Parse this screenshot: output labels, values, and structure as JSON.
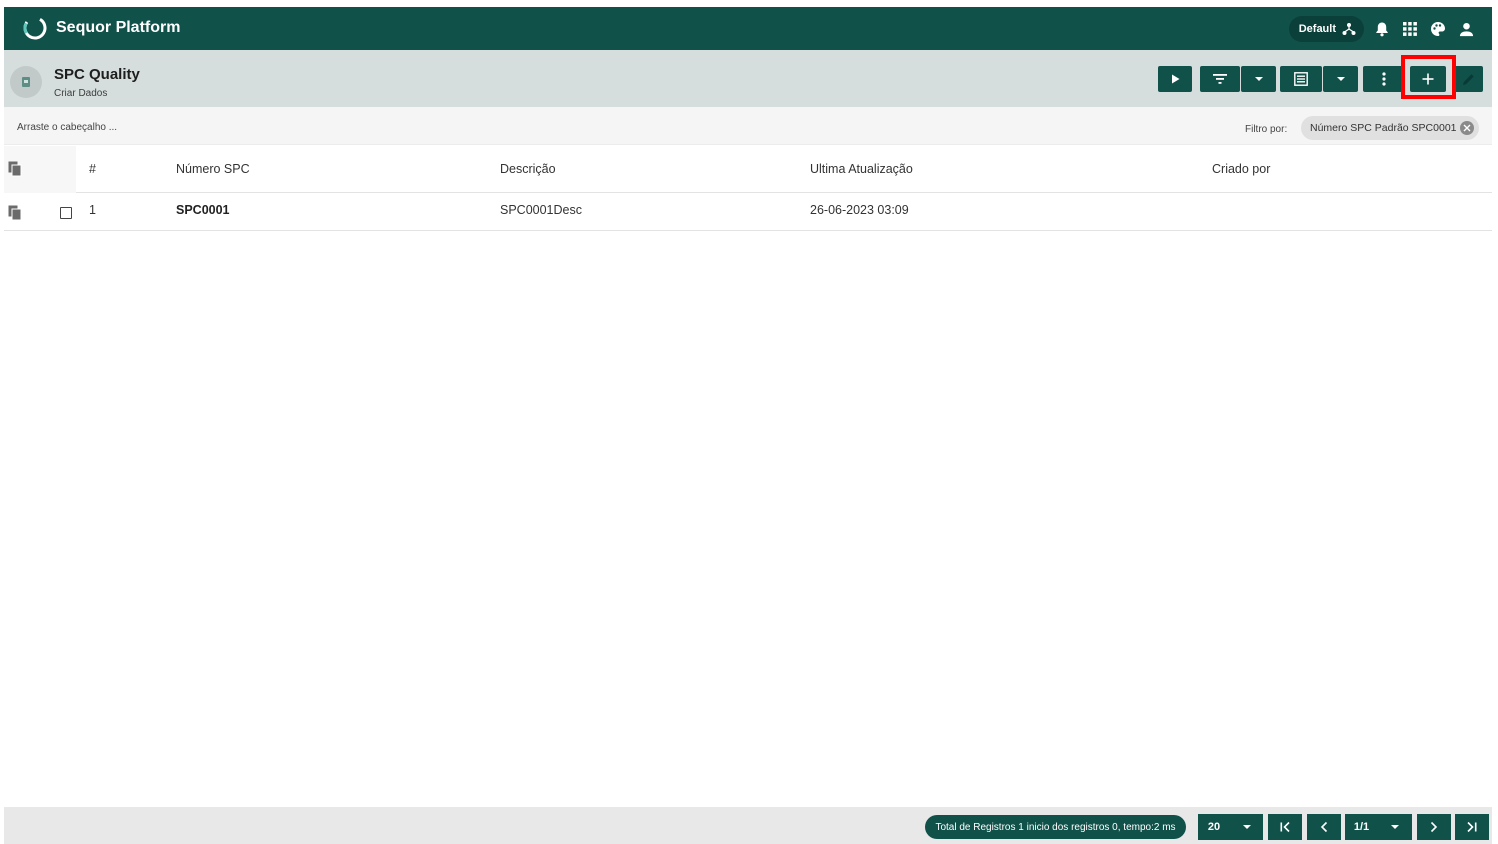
{
  "app": {
    "title": "Sequor Platform",
    "profile_label": "Default"
  },
  "module": {
    "title": "SPC Quality",
    "subtitle": "Criar Dados"
  },
  "group_bar": {
    "hint": "Arraste o cabeçalho ...",
    "filter_label": "Filtro por:",
    "filter_chip": "Número SPC Padrão SPC0001"
  },
  "table": {
    "columns": [
      "#",
      "Número SPC",
      "Descrição",
      "Ultima Atualização",
      "Criado por"
    ],
    "rows": [
      {
        "index": "1",
        "numero_spc": "SPC0001",
        "descricao": "SPC0001Desc",
        "ultima_atualizacao": "26-06-2023 03:09",
        "criado_por": ""
      }
    ]
  },
  "footer": {
    "status": "Total de Registros 1 inicio dos registros 0, tempo:2 ms",
    "page_size": "20",
    "page_indicator": "1/1"
  },
  "colors": {
    "primary": "#10514a",
    "subheader": "#d6dedd",
    "highlight": "#ff0000"
  },
  "icons": {
    "appbar": [
      "sequor-logo-icon",
      "hierarchy-icon",
      "bell-icon",
      "apps-grid-icon",
      "palette-icon",
      "person-icon"
    ],
    "toolbar": [
      "play-icon",
      "filter-icon",
      "caret-down-icon",
      "list-view-icon",
      "caret-down-icon",
      "more-vert-icon",
      "plus-icon",
      "pencil-icon"
    ]
  }
}
